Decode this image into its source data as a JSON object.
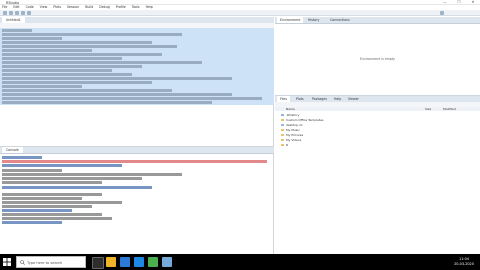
{
  "window": {
    "title": "RStudio",
    "minimize": "—",
    "maximize": "☐",
    "close": "✕"
  },
  "menu": [
    "File",
    "Edit",
    "Code",
    "View",
    "Plots",
    "Session",
    "Build",
    "Debug",
    "Profile",
    "Tools",
    "Help"
  ],
  "editor": {
    "tab": "Untitled1",
    "cursor": "1:1"
  },
  "console": {
    "tab": "Console"
  },
  "env": {
    "tabs": [
      "Environment",
      "History",
      "Connections"
    ],
    "message": "Environment is empty"
  },
  "files": {
    "tabs": [
      "Files",
      "Plots",
      "Packages",
      "Help",
      "Viewer"
    ],
    "header": [
      "Name",
      "Size",
      "Modified"
    ],
    "rows": [
      {
        "name": ".Rhistory",
        "size": "",
        "mod": ""
      },
      {
        "name": "Custom Office Templates",
        "size": "",
        "mod": ""
      },
      {
        "name": "desktop.ini",
        "size": "",
        "mod": ""
      },
      {
        "name": "My Music",
        "size": "",
        "mod": ""
      },
      {
        "name": "My Pictures",
        "size": "",
        "mod": ""
      },
      {
        "name": "My Videos",
        "size": "",
        "mod": ""
      },
      {
        "name": "R",
        "size": "",
        "mod": ""
      }
    ]
  },
  "taskbar": {
    "search": "Type here to search",
    "time": "11:04",
    "date": "20-03-2020"
  },
  "colors": {
    "selection": "#cde2f7",
    "pane_tabs": "#dde5ee",
    "taskbar": "#000000"
  }
}
